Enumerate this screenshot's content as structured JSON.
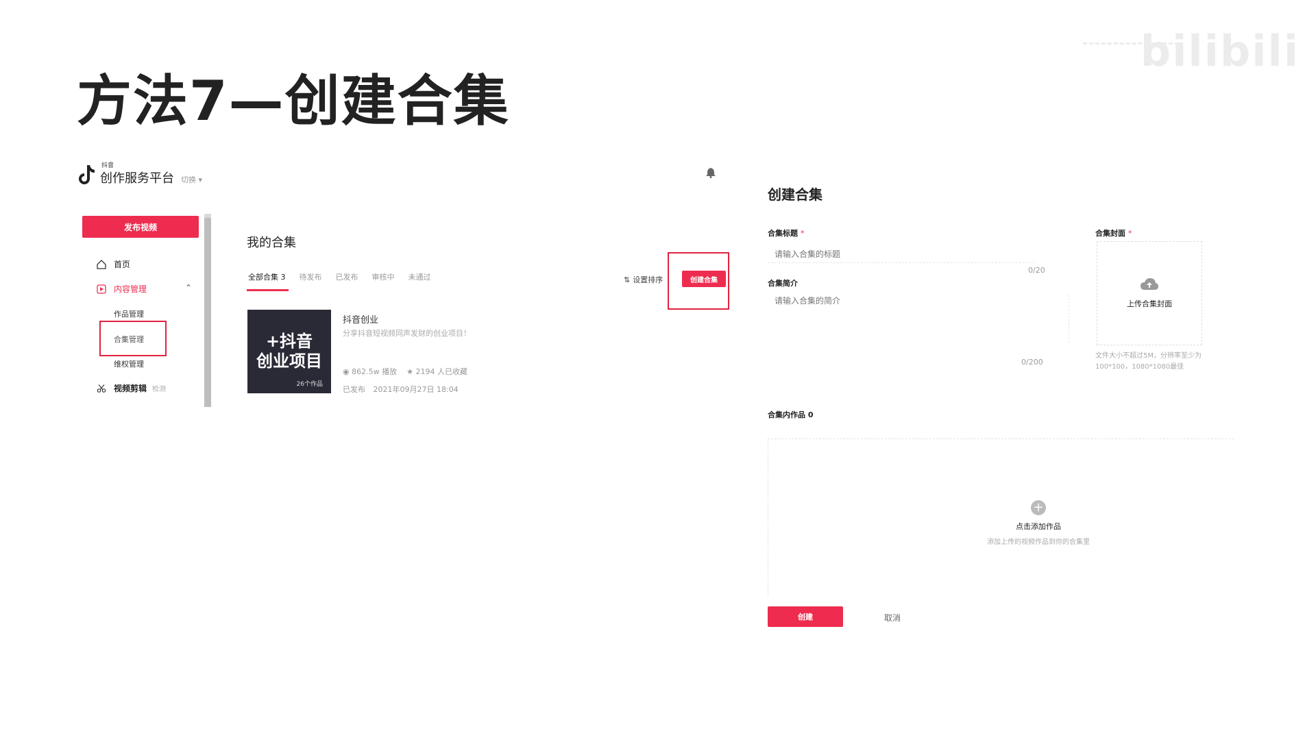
{
  "slide": {
    "title": "方法7—创建合集"
  },
  "watermark": {
    "text": "bilibili"
  },
  "app": {
    "brand_small": "抖音",
    "brand_name": "创作服务平台",
    "brand_sub": "切换 ▾",
    "publish_button": "发布视频"
  },
  "sidebar": {
    "home": "首页",
    "content_mgmt": "内容管理",
    "works_mgmt": "作品管理",
    "collection_mgmt": "合集管理",
    "rights_mgmt": "维权管理",
    "video_edit": "视频剪辑",
    "video_edit_tag": "检测"
  },
  "collections": {
    "title": "我的合集",
    "tabs": [
      {
        "label": "全部合集 3"
      },
      {
        "label": "待发布"
      },
      {
        "label": "已发布"
      },
      {
        "label": "审核中"
      },
      {
        "label": "未通过"
      }
    ],
    "sort_label": "设置排序",
    "create_label": "创建合集",
    "card": {
      "cover_line1": "+抖音",
      "cover_line2": "创业项目",
      "cover_count": "26个作品",
      "title": "抖音创业",
      "desc": "分享抖音短视频同声发财的创业项目！",
      "plays": "862.5w 播放",
      "favs": "2194 人已收藏",
      "status": "已发布",
      "date": "2021年09月27日 18:04"
    }
  },
  "form": {
    "title": "创建合集",
    "title_label": "合集标题",
    "title_placeholder": "请输入合集的标题",
    "title_counter": "0/20",
    "intro_label": "合集简介",
    "intro_placeholder": "请输入合集的简介",
    "intro_counter": "0/200",
    "cover_label": "合集封面",
    "cover_upload": "上传合集封面",
    "cover_hint": "文件大小不超过5M，分辨率至少为100*100，1080*1080最佳",
    "works_label": "合集内作品 0",
    "add_work": "点击添加作品",
    "add_work_hint": "添加上传的视频作品到你的合集里",
    "submit": "创建",
    "cancel": "取消",
    "required_mark": "*"
  },
  "colors": {
    "accent": "#ee2c4f",
    "highlight": "#e0223f"
  }
}
